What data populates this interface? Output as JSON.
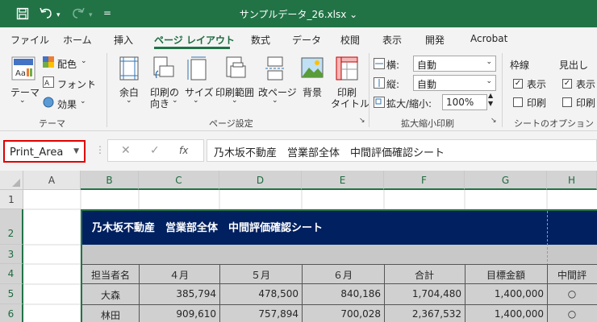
{
  "window": {
    "filename": "サンプルデータ_26.xlsx",
    "filename_arrow": "⌄"
  },
  "quick_access": {
    "customize_symbol": "="
  },
  "tabs": [
    "ファイル",
    "ホーム",
    "挿入",
    "ページ レイアウト",
    "数式",
    "データ",
    "校閲",
    "表示",
    "開発",
    "Acrobat"
  ],
  "active_tab": "ページ レイアウト",
  "ribbon": {
    "theme_group": {
      "label": "テーマ",
      "themes": "テーマ",
      "colors": "配色",
      "fonts": "フォント",
      "effects": "効果"
    },
    "page_setup_group": {
      "label": "ページ設定",
      "margins": "余白",
      "orientation_1": "印刷の",
      "orientation_2": "向き",
      "size": "サイズ",
      "print_area": "印刷範囲",
      "breaks": "改ページ",
      "background": "背景",
      "print_titles_1": "印刷",
      "print_titles_2": "タイトル"
    },
    "scale_group": {
      "label": "拡大縮小印刷",
      "width_label": "横:",
      "width_value": "自動",
      "height_label": "縦:",
      "height_value": "自動",
      "scale_label": "拡大/縮小:",
      "scale_value": "100%"
    },
    "sheet_options_group": {
      "label": "シートのオプション",
      "gridlines": "枠線",
      "headings": "見出し",
      "view": "表示",
      "print": "印刷"
    }
  },
  "formula_bar": {
    "name_box": "Print_Area",
    "fx": "fx",
    "cancel": "✕",
    "enter": "✓",
    "content": "乃木坂不動産　営業部全体　中間評価確認シート"
  },
  "columns": [
    "A",
    "B",
    "C",
    "D",
    "E",
    "F",
    "G",
    "H"
  ],
  "rows": [
    "1",
    "2",
    "3",
    "4",
    "5",
    "6"
  ],
  "sheet": {
    "title": "乃木坂不動産　営業部全体　中間評価確認シート",
    "headers": [
      "担当者名",
      "４月",
      "５月",
      "６月",
      "合計",
      "目標金額",
      "中間評"
    ],
    "data": [
      [
        "大森",
        "385,794",
        "478,500",
        "840,186",
        "1,704,480",
        "1,400,000",
        "○"
      ],
      [
        "林田",
        "909,610",
        "757,894",
        "700,028",
        "2,367,532",
        "1,400,000",
        "○"
      ]
    ]
  },
  "colors": {
    "excel_green": "#217346",
    "title_banner": "#002060",
    "selection_red": "#e00000"
  }
}
